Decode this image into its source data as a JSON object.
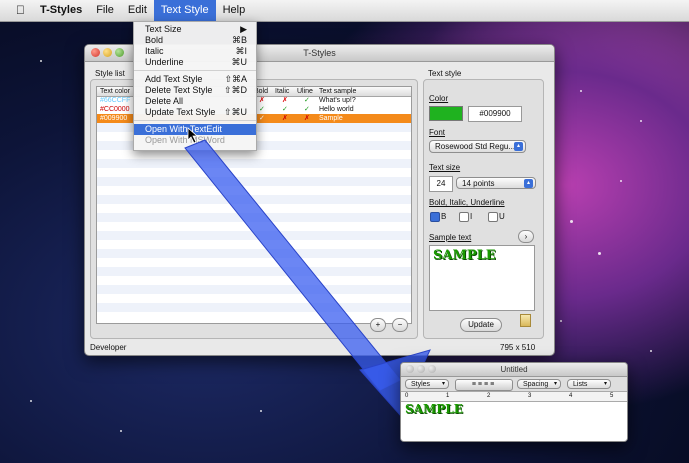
{
  "menubar": {
    "app_name": "T-Styles",
    "items": [
      "File",
      "Edit",
      "Text Style",
      "Help"
    ]
  },
  "main_window": {
    "title": "T-Styles",
    "style_list_label": "Style list",
    "text_style_label": "Text style",
    "columns": [
      "Text color",
      "Bold",
      "Italic",
      "Uline",
      "Text sample"
    ],
    "rows": [
      {
        "color": "#66CCFF",
        "bold": "✗",
        "italic": "✗",
        "uline": "✓",
        "sample": "What's up!?"
      },
      {
        "color": "#CC0000",
        "bold": "✓",
        "italic": "✓",
        "uline": "✓",
        "sample": "Hello world"
      },
      {
        "color": "#009900",
        "bold": "✓",
        "italic": "✗",
        "uline": "✗",
        "sample": "Sample"
      }
    ],
    "status_left": "Developer",
    "status_right": "795 x 510",
    "add_button": "+",
    "remove_button": "−"
  },
  "text_style_panel": {
    "color_label": "Color",
    "color_swatch": "#1fb21f",
    "color_value": "#009900",
    "font_label": "Font",
    "font_value": "Rosewood Std Regu...",
    "size_label": "Text size",
    "size_value": "24",
    "size_popup": "14 points",
    "biu_label": "Bold, Italic, Underline",
    "b_label": "B",
    "i_label": "I",
    "u_label": "U",
    "sample_label": "Sample text",
    "sample_text": "SAMPLE",
    "update_button": "Update"
  },
  "menu": {
    "items": [
      {
        "label": "Text Size",
        "key": "▶"
      },
      {
        "label": "Bold",
        "key": "⌘B"
      },
      {
        "label": "Italic",
        "key": "⌘I"
      },
      {
        "label": "Underline",
        "key": "⌘U"
      },
      {
        "label": "Add Text Style",
        "key": "⇧⌘A"
      },
      {
        "label": "Delete Text Style",
        "key": "⇧⌘D"
      },
      {
        "label": "Delete All",
        "key": ""
      },
      {
        "label": "Update Text Style",
        "key": "⇧⌘U"
      },
      {
        "label": "Open With TextEdit",
        "key": ""
      },
      {
        "label": "Open With MSWord",
        "key": ""
      }
    ]
  },
  "textedit_window": {
    "title": "Untitled",
    "styles": "Styles",
    "spacing": "Spacing",
    "lists": "Lists",
    "ruler": [
      "0",
      "1",
      "2",
      "3",
      "4",
      "5"
    ],
    "content": "SAMPLE"
  }
}
